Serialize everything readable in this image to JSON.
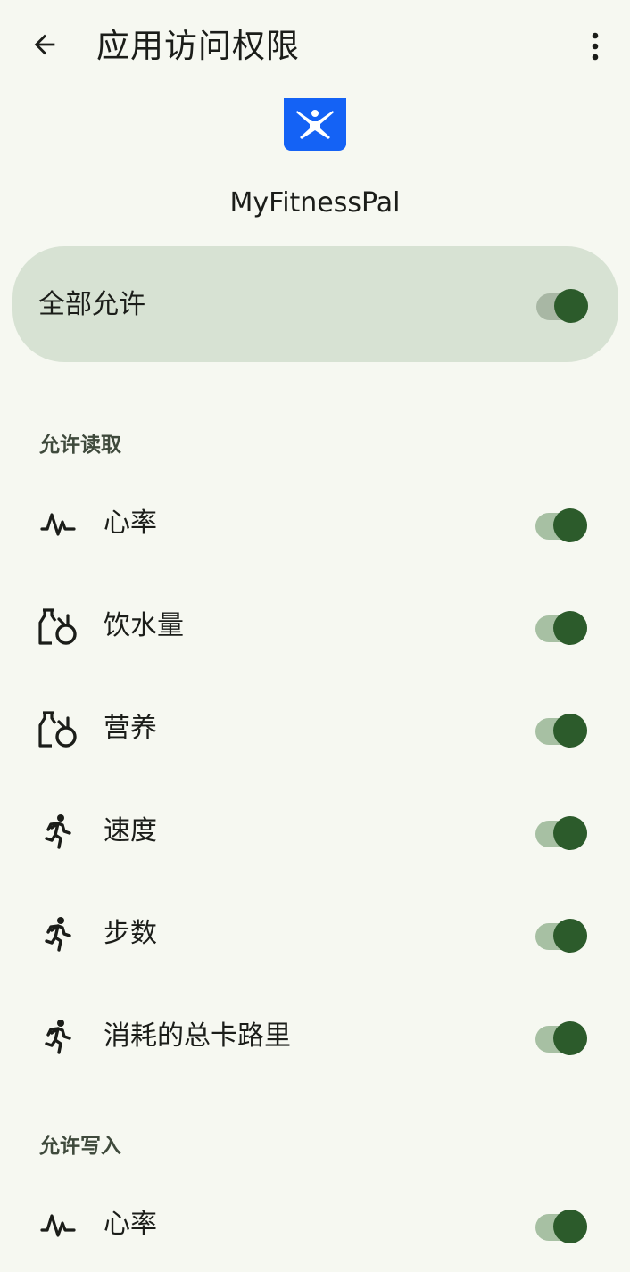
{
  "header": {
    "title": "应用访问权限",
    "back_icon": "arrow-back-icon",
    "more_icon": "more-vert-icon"
  },
  "app": {
    "name": "MyFitnessPal",
    "icon": "myfitnesspal-logo-icon",
    "icon_color": "#1462f5"
  },
  "allow_all": {
    "label": "全部允许",
    "enabled": true
  },
  "read_section": {
    "title": "允许读取",
    "items": [
      {
        "label": "心率",
        "icon": "heart-rate-icon",
        "enabled": true
      },
      {
        "label": "饮水量",
        "icon": "nutrition-icon",
        "enabled": true
      },
      {
        "label": "营养",
        "icon": "nutrition-icon",
        "enabled": true
      },
      {
        "label": "速度",
        "icon": "running-person-icon",
        "enabled": true
      },
      {
        "label": "步数",
        "icon": "running-person-icon",
        "enabled": true
      },
      {
        "label": "消耗的总卡路里",
        "icon": "running-person-icon",
        "enabled": true
      }
    ]
  },
  "write_section": {
    "title": "允许写入",
    "items": [
      {
        "label": "心率",
        "icon": "heart-rate-icon",
        "enabled": true
      }
    ]
  },
  "colors": {
    "background": "#f6f8f1",
    "card": "#d7e2d3",
    "switch_thumb": "#2c5b2b",
    "switch_track": "#a7c0a3"
  }
}
